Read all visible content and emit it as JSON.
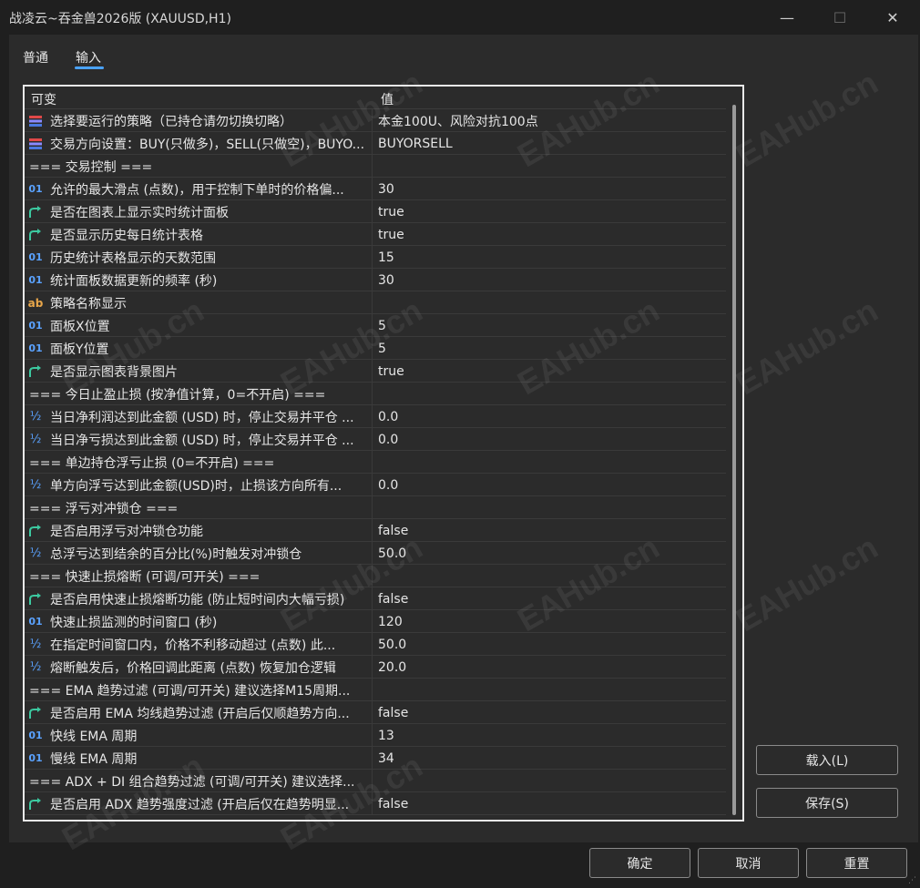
{
  "window": {
    "title": "战凌云~吞金兽2026版 (XAUUSD,H1)",
    "minimize_icon": "minimize-icon",
    "maximize_icon": "maximize-icon",
    "close_icon": "close-icon"
  },
  "tabs": [
    {
      "label": "普通"
    },
    {
      "label": "输入"
    }
  ],
  "grid": {
    "col_variable": "可变",
    "col_value": "值",
    "rows": [
      {
        "icon": "enum",
        "name": "选择要运行的策略（已持仓请勿切换切略）",
        "value": "本金100U、风险对抗100点"
      },
      {
        "icon": "enum",
        "name": "交易方向设置：BUY(只做多)，SELL(只做空)，BUYO...",
        "value": "BUYORSELL"
      },
      {
        "icon": "none",
        "name": "=== 交易控制 ===",
        "value": ""
      },
      {
        "icon": "int",
        "name": "允许的最大滑点 (点数)，用于控制下单时的价格偏...",
        "value": "30"
      },
      {
        "icon": "bool",
        "name": "是否在图表上显示实时统计面板",
        "value": "true"
      },
      {
        "icon": "bool",
        "name": "是否显示历史每日统计表格",
        "value": "true"
      },
      {
        "icon": "int",
        "name": "历史统计表格显示的天数范围",
        "value": "15"
      },
      {
        "icon": "int",
        "name": "统计面板数据更新的频率 (秒)",
        "value": "30"
      },
      {
        "icon": "str",
        "name": "策略名称显示",
        "value": ""
      },
      {
        "icon": "int",
        "name": "面板X位置",
        "value": "5"
      },
      {
        "icon": "int",
        "name": "面板Y位置",
        "value": "5"
      },
      {
        "icon": "bool",
        "name": "是否显示图表背景图片",
        "value": "true"
      },
      {
        "icon": "none",
        "name": "=== 今日止盈止损 (按净值计算，0=不开启) ===",
        "value": ""
      },
      {
        "icon": "dbl",
        "name": "当日净利润达到此金额 (USD) 时，停止交易并平仓 ...",
        "value": "0.0"
      },
      {
        "icon": "dbl",
        "name": "当日净亏损达到此金额 (USD) 时，停止交易并平仓 ...",
        "value": "0.0"
      },
      {
        "icon": "none",
        "name": "=== 单边持仓浮亏止损 (0=不开启) ===",
        "value": ""
      },
      {
        "icon": "dbl",
        "name": "单方向浮亏达到此金额(USD)时，止损该方向所有...",
        "value": "0.0"
      },
      {
        "icon": "none",
        "name": "=== 浮亏对冲锁仓 ===",
        "value": ""
      },
      {
        "icon": "bool",
        "name": "是否启用浮亏对冲锁仓功能",
        "value": "false"
      },
      {
        "icon": "dbl",
        "name": "总浮亏达到结余的百分比(%)时触发对冲锁仓",
        "value": "50.0"
      },
      {
        "icon": "none",
        "name": "=== 快速止损熔断 (可调/可开关) ===",
        "value": ""
      },
      {
        "icon": "bool",
        "name": "是否启用快速止损熔断功能 (防止短时间内大幅亏损)",
        "value": "false"
      },
      {
        "icon": "int",
        "name": "快速止损监测的时间窗口 (秒)",
        "value": "120"
      },
      {
        "icon": "dbl",
        "name": "在指定时间窗口内，价格不利移动超过 (点数) 此...",
        "value": "50.0"
      },
      {
        "icon": "dbl",
        "name": "熔断触发后，价格回调此距离 (点数) 恢复加仓逻辑",
        "value": "20.0"
      },
      {
        "icon": "none",
        "name": "===  EMA 趋势过滤 (可调/可开关) 建议选择M15周期...",
        "value": ""
      },
      {
        "icon": "bool",
        "name": "是否启用 EMA 均线趋势过滤 (开启后仅顺趋势方向...",
        "value": "false"
      },
      {
        "icon": "int",
        "name": "快线 EMA 周期",
        "value": "13"
      },
      {
        "icon": "int",
        "name": "慢线 EMA 周期",
        "value": "34"
      },
      {
        "icon": "none",
        "name": "=== ADX + DI 组合趋势过滤 (可调/可开关) 建议选择...",
        "value": ""
      },
      {
        "icon": "bool",
        "name": "是否启用 ADX 趋势强度过滤 (开启后仅在趋势明显...",
        "value": "false"
      }
    ]
  },
  "buttons": {
    "load": "载入(L)",
    "save": "保存(S)",
    "ok": "确定",
    "cancel": "取消",
    "reset": "重置"
  },
  "icon_glyphs": {
    "int": "01",
    "str": "ab",
    "dbl": "½"
  },
  "colors": {
    "int_icon": "#5aa2ff",
    "str_icon": "#e8a64a",
    "bool_icon": "#3cc9a0",
    "enum_icon_top": "#e04848",
    "enum_icon_bottom": "#4a78e0",
    "tab_accent": "#4aa3ff"
  },
  "watermark": "EAHub.cn"
}
